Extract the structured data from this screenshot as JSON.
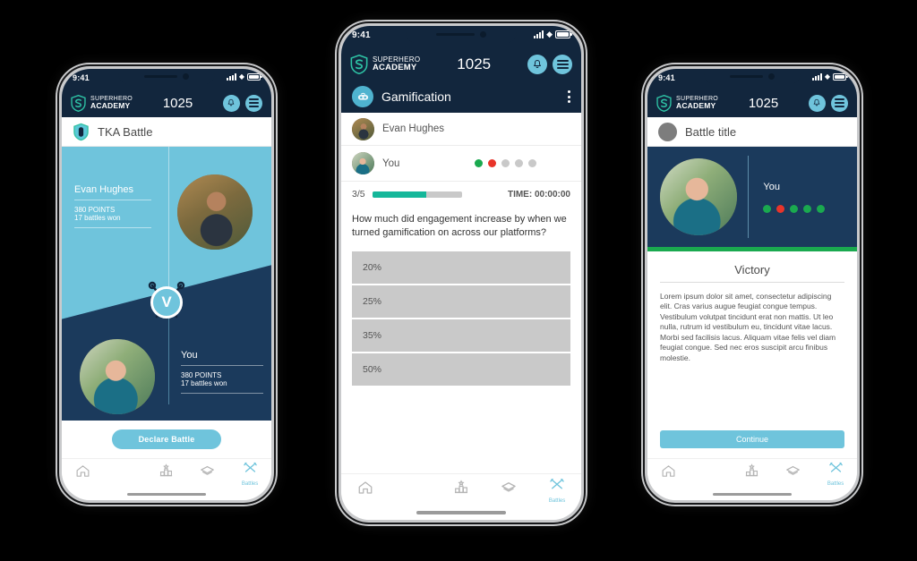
{
  "app": {
    "brand_line1": "SUPERHERO",
    "brand_line2": "ACADEMY",
    "points": "1025",
    "status_time": "9:41",
    "bell_icon": "bell-icon",
    "menu_icon": "hamburger-menu-icon"
  },
  "colors": {
    "navy": "#12263d",
    "navy_panel": "#1b3a5c",
    "teal": "#6fc4dc",
    "progress_green": "#15b79a",
    "green": "#1aa94f",
    "red": "#e8342a",
    "gray": "#c9c9c9"
  },
  "nav": {
    "items": [
      {
        "icon": "home-icon",
        "label": ""
      },
      {
        "icon": "chat-bubble-icon",
        "label": ""
      },
      {
        "icon": "leaderboard-podium-icon",
        "label": ""
      },
      {
        "icon": "cards-layers-icon",
        "label": ""
      },
      {
        "icon": "battles-swords-icon",
        "label": "Battles"
      }
    ],
    "active_index": 4
  },
  "phone1": {
    "title": "TKA Battle",
    "title_icon": "shield-badge-icon",
    "opponent": {
      "name": "Evan Hughes",
      "points": "380 POINTS",
      "battles": "17 battles won",
      "avatar": "avatar-evan-hughes"
    },
    "you": {
      "name": "You",
      "points": "380 POINTS",
      "battles": "17 battles won",
      "avatar": "avatar-you"
    },
    "versus_badge": "V",
    "cta": "Declare Battle"
  },
  "phone2": {
    "title": "Gamification",
    "title_icon": "gamepad-controller-icon",
    "overflow_icon": "more-vertical-icon",
    "players": [
      {
        "name": "Evan Hughes",
        "avatar": "avatar-evan-hughes",
        "dots": []
      },
      {
        "name": "You",
        "avatar": "avatar-you",
        "dots": [
          "green",
          "red",
          "gray",
          "gray",
          "gray"
        ]
      }
    ],
    "progress_label": "3/5",
    "progress_percent": 60,
    "time_label": "TIME: 00:00:00",
    "question": "How much did engagement increase by when we turned gamification on across our platforms?",
    "answers": [
      "20%",
      "25%",
      "35%",
      "50%"
    ]
  },
  "phone3": {
    "title": "Battle title",
    "title_icon": "placeholder-circle-icon",
    "you_label": "You",
    "you_dots": [
      "green",
      "red",
      "green",
      "green",
      "green"
    ],
    "avatar": "avatar-you",
    "result_title": "Victory",
    "body_text": "Lorem ipsum dolor sit amet, consectetur adipiscing elit. Cras varius augue feugiat congue tempus. Vestibulum volutpat tincidunt erat non mattis. Ut leo nulla, rutrum id vestibulum eu, tincidunt vitae lacus. Morbi sed facilisis lacus. Aliquam vitae felis vel diam feugiat congue. Sed nec eros suscipit arcu finibus molestie.",
    "cta": "Continue"
  }
}
